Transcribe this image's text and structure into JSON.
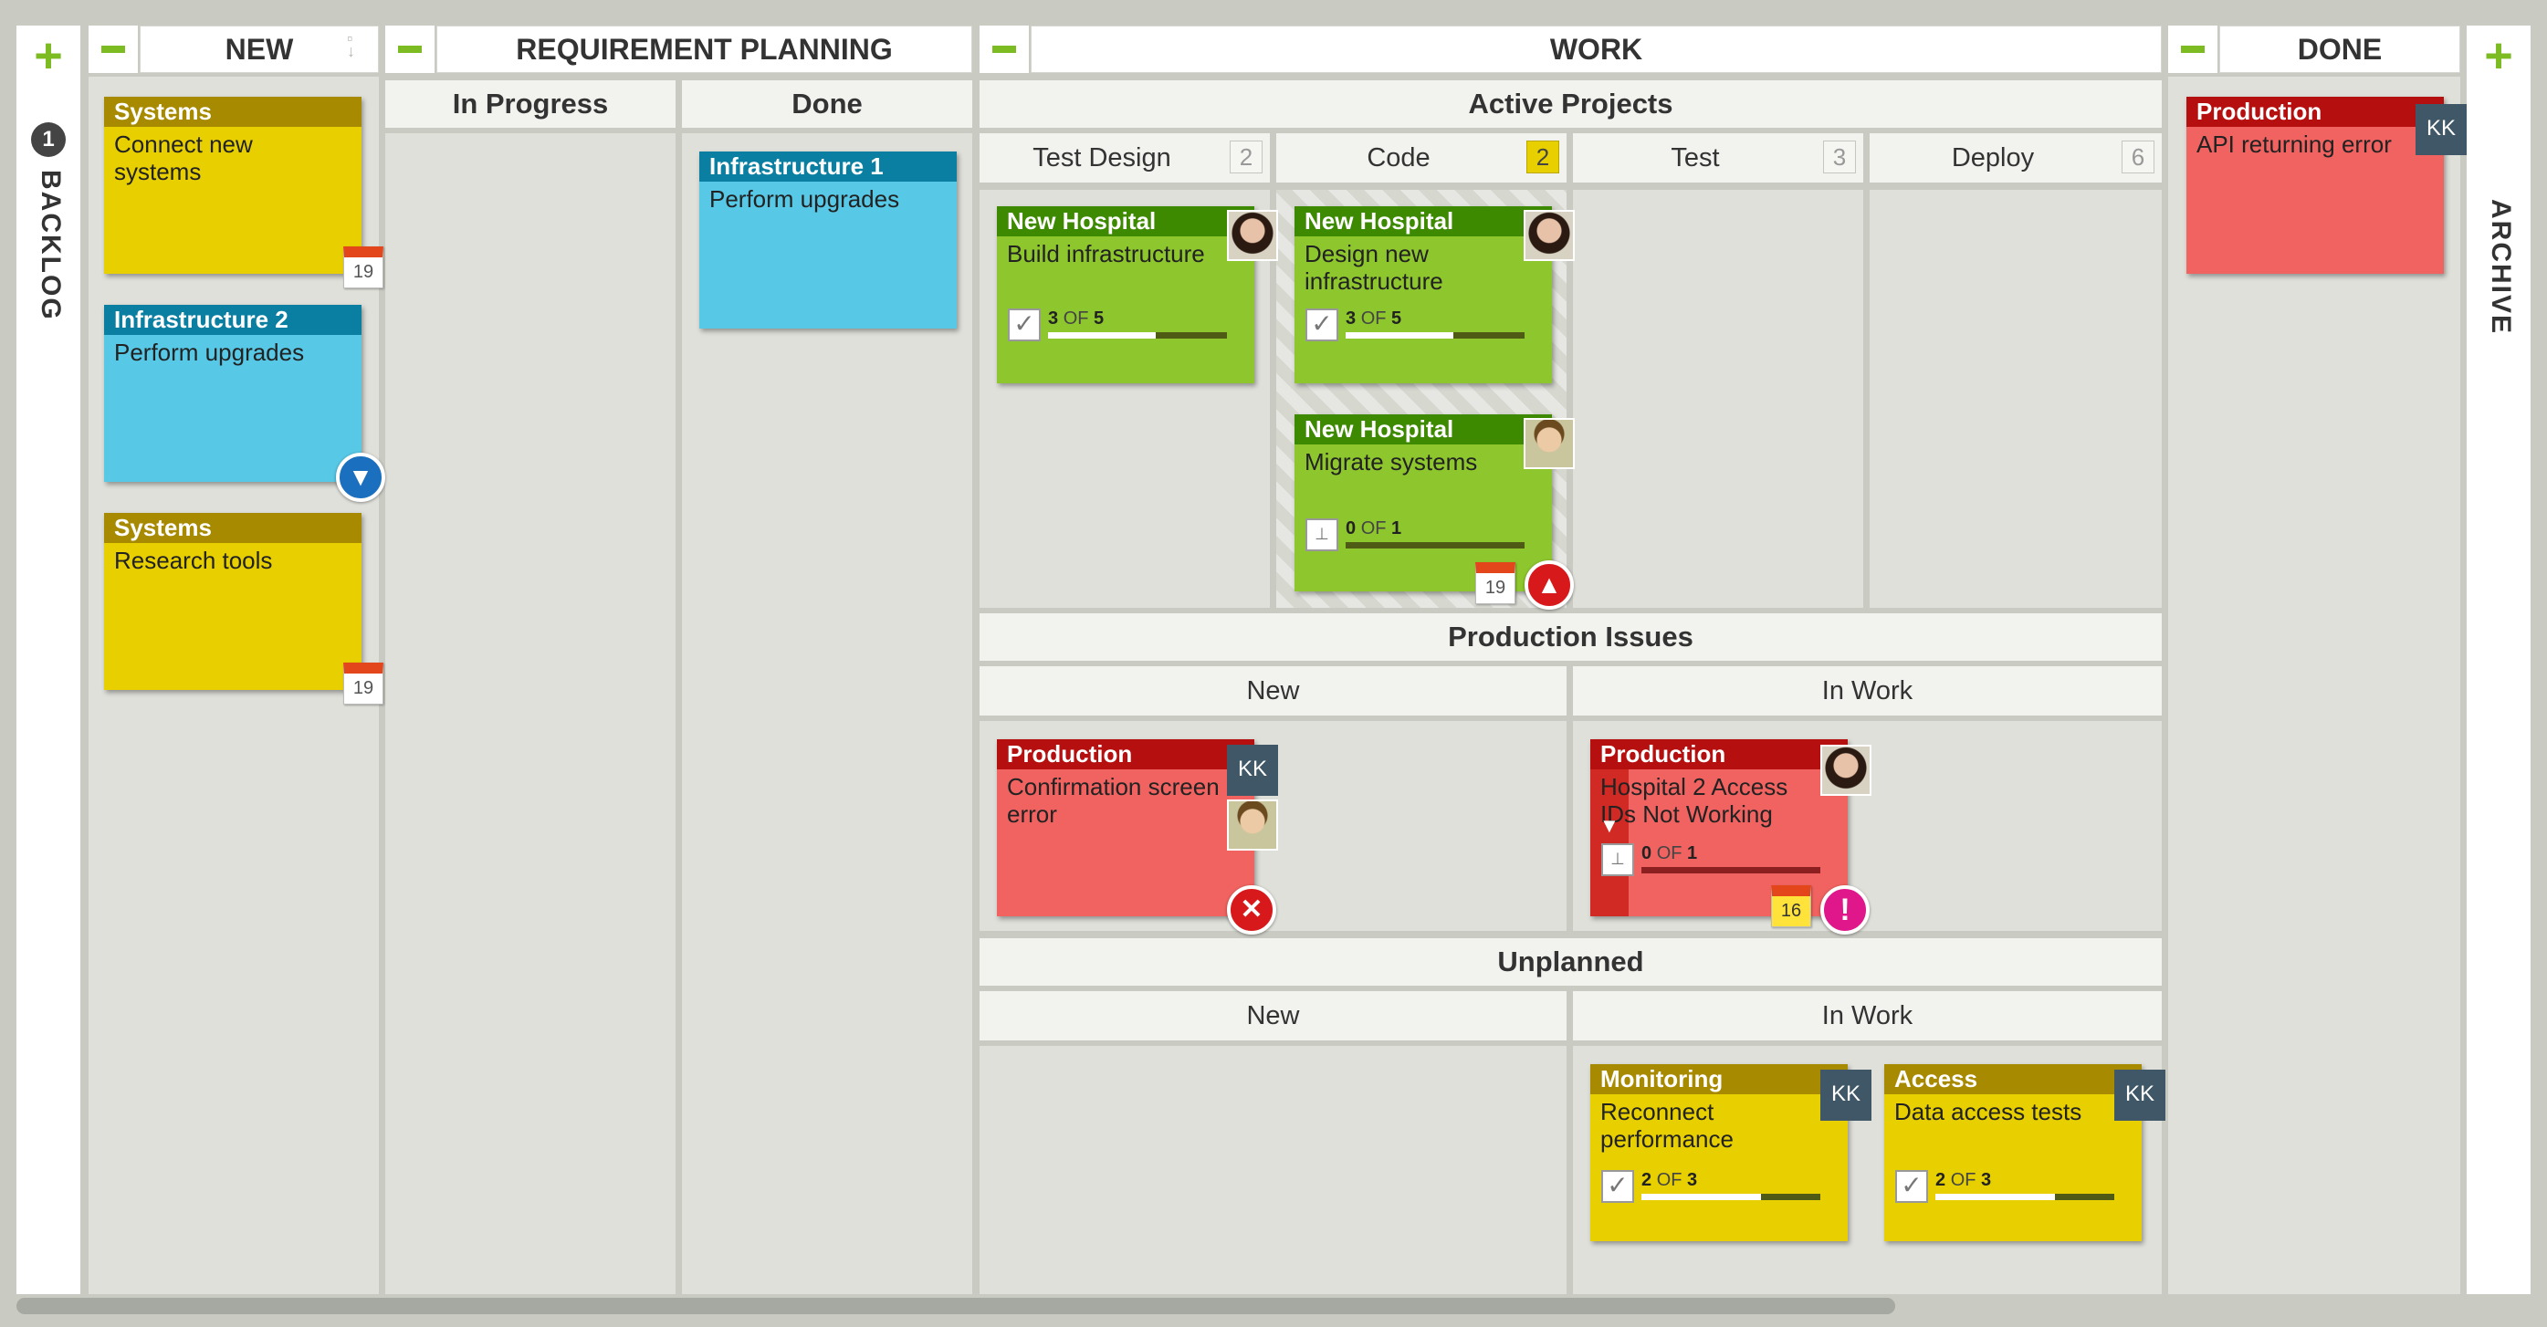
{
  "board": {
    "backlog": {
      "label": "BACKLOG",
      "count": "1"
    },
    "archive": {
      "label": "ARCHIVE"
    },
    "add_icon": "+",
    "headers": {
      "new": "NEW",
      "requirement_planning": "REQUIREMENT PLANNING",
      "work": "WORK",
      "done": "DONE"
    },
    "req_sub": {
      "in_progress": "In Progress",
      "done": "Done"
    },
    "work": {
      "active_projects": "Active Projects",
      "columns": [
        {
          "label": "Test Design",
          "count": "2"
        },
        {
          "label": "Code",
          "count": "2"
        },
        {
          "label": "Test",
          "count": "3"
        },
        {
          "label": "Deploy",
          "count": "6"
        }
      ],
      "production_issues": "Production Issues",
      "pi_new": "New",
      "pi_in_work": "In Work",
      "unplanned": "Unplanned",
      "un_new": "New",
      "un_in_work": "In Work"
    }
  },
  "cards": {
    "c1": {
      "title": "Systems",
      "body": "Connect new systems",
      "date": "19"
    },
    "c2": {
      "title": "Infrastructure 2",
      "body": "Perform upgrades"
    },
    "c3": {
      "title": "Systems",
      "body": "Research tools",
      "date": "19"
    },
    "c4": {
      "title": "Infrastructure 1",
      "body": "Perform upgrades"
    },
    "c5": {
      "title": "New Hospital",
      "body": "Build infrastructure",
      "done": "3",
      "of": "OF",
      "total": "5",
      "progress": 0.6
    },
    "c6": {
      "title": "New Hospital",
      "body": "Design new infrastructure",
      "done": "3",
      "of": "OF",
      "total": "5",
      "progress": 0.6
    },
    "c7": {
      "title": "New Hospital",
      "body": "Migrate systems",
      "done": "0",
      "of": "OF",
      "total": "1",
      "progress": 0.0,
      "date": "19"
    },
    "c8": {
      "title": "Production",
      "body": "API returning error",
      "user": "KK"
    },
    "c9": {
      "title": "Production",
      "body": "Confirmation screen error",
      "user": "KK"
    },
    "c10": {
      "title": "Production",
      "body": "Hospital 2 Access IDs Not Working",
      "done": "0",
      "of": "OF",
      "total": "1",
      "progress": 0.0,
      "date": "16"
    },
    "c11": {
      "title": "Monitoring",
      "body": "Reconnect performance",
      "done": "2",
      "of": "OF",
      "total": "3",
      "progress": 0.67,
      "user": "KK"
    },
    "c12": {
      "title": "Access",
      "body": "Data access tests",
      "done": "2",
      "of": "OF",
      "total": "3",
      "progress": 0.67,
      "user": "KK"
    }
  },
  "icons": {
    "check": "✓",
    "down": "▼",
    "up": "▲",
    "cross": "✕",
    "excl": "!"
  },
  "colors": {
    "accent": "#7dbb22",
    "yellow": "#e7cf00",
    "cyan": "#57c8e6",
    "green": "#8ec62e",
    "red": "#f06360"
  }
}
